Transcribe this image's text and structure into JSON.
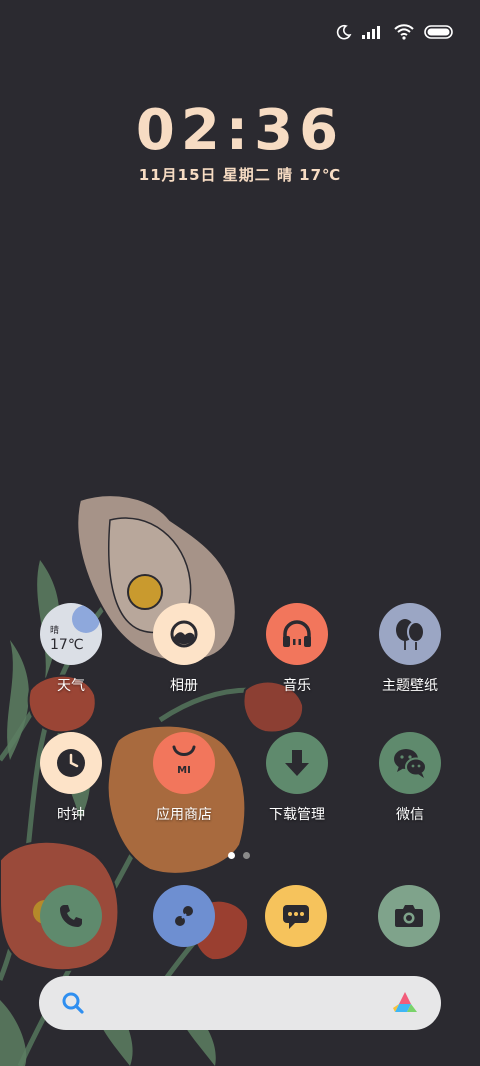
{
  "status_bar": {
    "icons": [
      "moon-icon",
      "signal-icon",
      "wifi-icon",
      "battery-icon"
    ]
  },
  "clock": {
    "time": "02:36",
    "date_line": "11月15日  星期二  晴  17℃"
  },
  "weather_widget": {
    "condition": "晴",
    "temperature": "17℃"
  },
  "apps": [
    {
      "label": "天气",
      "icon": "weather-icon",
      "color": "#8ea5cf"
    },
    {
      "label": "相册",
      "icon": "gallery-icon",
      "color": "#fde3c8"
    },
    {
      "label": "音乐",
      "icon": "headphones-icon",
      "color": "#f2765c"
    },
    {
      "label": "主题壁纸",
      "icon": "balloons-icon",
      "color": "#9ba6c4"
    },
    {
      "label": "时钟",
      "icon": "clock-icon",
      "color": "#fde3c8"
    },
    {
      "label": "应用商店",
      "icon": "shopping-bag-icon",
      "color": "#f2765c"
    },
    {
      "label": "下载管理",
      "icon": "download-arrow-icon",
      "color": "#5f8a6d"
    },
    {
      "label": "微信",
      "icon": "wechat-icon",
      "color": "#5f8a6d"
    }
  ],
  "store_badge": "MI",
  "page_indicator": {
    "pages": 2,
    "current": 1
  },
  "dock": [
    {
      "icon": "phone-icon",
      "color": "#5f8a6d"
    },
    {
      "icon": "contacts-link-icon",
      "color": "#6e8fd1"
    },
    {
      "icon": "message-icon",
      "color": "#f6c35c"
    },
    {
      "icon": "camera-icon",
      "color": "#7fa38b"
    }
  ],
  "search": {
    "icon": "search-icon",
    "assistant_icon": "assistant-logo-icon"
  }
}
